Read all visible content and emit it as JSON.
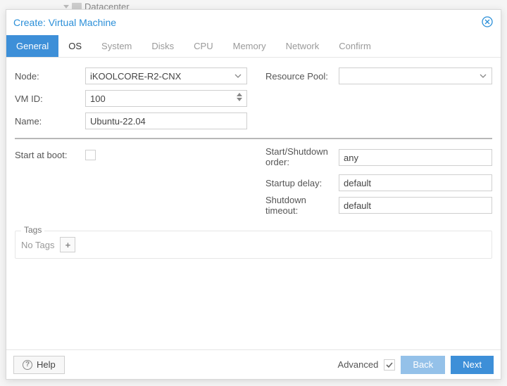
{
  "bg": {
    "tree_root": "Datacenter"
  },
  "dialog": {
    "title": "Create: Virtual Machine"
  },
  "tabs": [
    {
      "label": "General",
      "active": true,
      "enabled": true
    },
    {
      "label": "OS",
      "active": false,
      "enabled": true
    },
    {
      "label": "System",
      "active": false,
      "enabled": false
    },
    {
      "label": "Disks",
      "active": false,
      "enabled": false
    },
    {
      "label": "CPU",
      "active": false,
      "enabled": false
    },
    {
      "label": "Memory",
      "active": false,
      "enabled": false
    },
    {
      "label": "Network",
      "active": false,
      "enabled": false
    },
    {
      "label": "Confirm",
      "active": false,
      "enabled": false
    }
  ],
  "form": {
    "node_label": "Node:",
    "node_value": "iKOOLCORE-R2-CNX",
    "vmid_label": "VM ID:",
    "vmid_value": "100",
    "name_label": "Name:",
    "name_value": "Ubuntu-22.04",
    "resourcepool_label": "Resource Pool:",
    "resourcepool_value": "",
    "startatboot_label": "Start at boot:",
    "startatboot_checked": false,
    "startorder_label": "Start/Shutdown order:",
    "startorder_value": "any",
    "startupdelay_label": "Startup delay:",
    "startupdelay_value": "default",
    "shutdowntimeout_label": "Shutdown timeout:",
    "shutdowntimeout_value": "default"
  },
  "tags": {
    "legend": "Tags",
    "empty_text": "No Tags"
  },
  "footer": {
    "help": "Help",
    "advanced": "Advanced",
    "advanced_checked": true,
    "back": "Back",
    "next": "Next"
  }
}
